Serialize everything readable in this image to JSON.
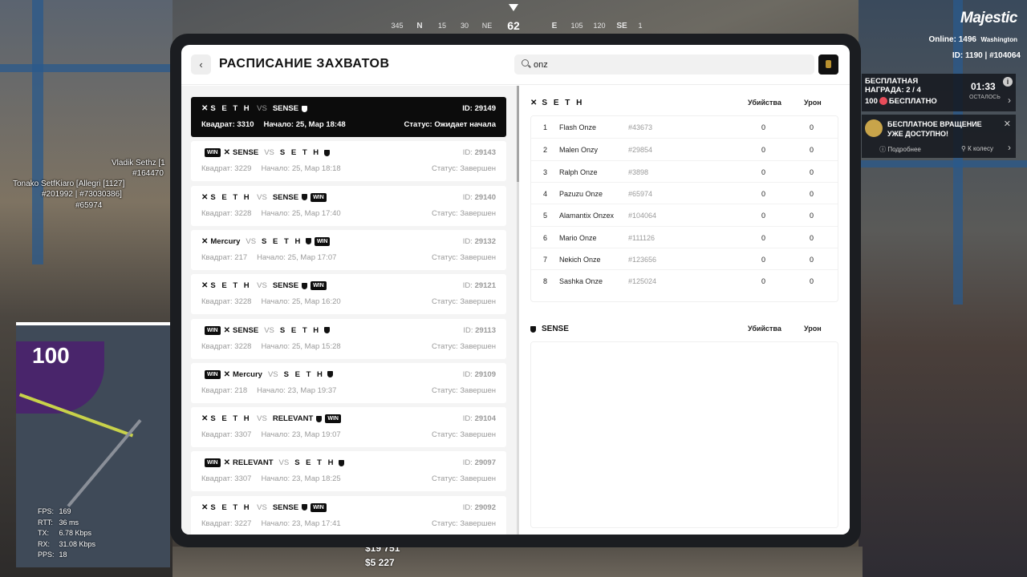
{
  "compass": {
    "heading": "62",
    "marks": [
      "345",
      "N",
      "15",
      "30",
      "NE",
      "E",
      "105",
      "120",
      "SE",
      "1"
    ]
  },
  "players": [
    "Vladik Sethz [1",
    "#164470",
    "Tonako SetfKiaro [Allegri [1127]",
    "#201992 | #73030386]",
    "#65974"
  ],
  "minimap": {
    "level": "100"
  },
  "stats": [
    {
      "k": "FPS:",
      "v": "169"
    },
    {
      "k": "RTT:",
      "v": "36 ms"
    },
    {
      "k": "TX:",
      "v": "6.78 Kbps"
    },
    {
      "k": "RX:",
      "v": "31.08 Kbps"
    },
    {
      "k": "PPS:",
      "v": "18"
    }
  ],
  "money": {
    "cash": "$19 751",
    "bank": "$5 227"
  },
  "hud": {
    "logo": "Majestic",
    "online": "Online: 1496",
    "server": "Washington",
    "ids": "ID: 1190 | #104064",
    "reward_title": "БЕСПЛАТНАЯ НАГРАДА: 2 / 4",
    "reward_sub_num": "100",
    "reward_sub": "БЕСПЛАТНО",
    "reward_time": "01:33",
    "reward_time_label": "ОСТАЛОСЬ",
    "spin_title": "БЕСПЛАТНОЕ ВРАЩЕНИЕ УЖЕ ДОСТУПНО!",
    "spin_more": "Подробнее",
    "spin_wheel": "К колесу"
  },
  "header": {
    "title": "РАСПИСАНИЕ ЗАХВАТОВ",
    "search_value": "onz"
  },
  "labels": {
    "vs": "VS",
    "win": "WIN",
    "square": "Квадрат:",
    "start": "Начало:",
    "status": "Статус:",
    "id": "ID:"
  },
  "captures": [
    {
      "a": "S E T H",
      "b": "SENSE",
      "win": "",
      "id": "29149",
      "square": "3310",
      "start": "25, Мар 18:48",
      "status": "Ожидает начала"
    },
    {
      "a": "SENSE",
      "b": "S E T H",
      "win": "a",
      "id": "29143",
      "square": "3229",
      "start": "25, Мар 18:18",
      "status": "Завершен"
    },
    {
      "a": "S E T H",
      "b": "SENSE",
      "win": "b",
      "id": "29140",
      "square": "3228",
      "start": "25, Мар 17:40",
      "status": "Завершен"
    },
    {
      "a": "Mercury",
      "b": "S E T H",
      "win": "b",
      "id": "29132",
      "square": "217",
      "start": "25, Мар 17:07",
      "status": "Завершен"
    },
    {
      "a": "S E T H",
      "b": "SENSE",
      "win": "b",
      "id": "29121",
      "square": "3228",
      "start": "25, Мар 16:20",
      "status": "Завершен"
    },
    {
      "a": "SENSE",
      "b": "S E T H",
      "win": "a",
      "id": "29113",
      "square": "3228",
      "start": "25, Мар 15:28",
      "status": "Завершен"
    },
    {
      "a": "Mercury",
      "b": "S E T H",
      "win": "a",
      "id": "29109",
      "square": "218",
      "start": "23, Мар 19:37",
      "status": "Завершен"
    },
    {
      "a": "S E T H",
      "b": "RELEVANT",
      "win": "b",
      "id": "29104",
      "square": "3307",
      "start": "23, Мар 19:07",
      "status": "Завершен"
    },
    {
      "a": "RELEVANT",
      "b": "S E T H",
      "win": "a",
      "id": "29097",
      "square": "3307",
      "start": "23, Мар 18:25",
      "status": "Завершен"
    },
    {
      "a": "S E T H",
      "b": "SENSE",
      "win": "b",
      "id": "29092",
      "square": "3227",
      "start": "23, Мар 17:41",
      "status": "Завершен"
    }
  ],
  "detail": {
    "team1": "S E T H",
    "team2": "SENSE",
    "kills_label": "Убийства",
    "damage_label": "Урон",
    "players": [
      {
        "n": "1",
        "name": "Flash Onze",
        "id": "#43673",
        "kills": "0",
        "damage": "0"
      },
      {
        "n": "2",
        "name": "Malen Onzy",
        "id": "#29854",
        "kills": "0",
        "damage": "0"
      },
      {
        "n": "3",
        "name": "Ralph Onze",
        "id": "#3898",
        "kills": "0",
        "damage": "0"
      },
      {
        "n": "4",
        "name": "Pazuzu Onze",
        "id": "#65974",
        "kills": "0",
        "damage": "0"
      },
      {
        "n": "5",
        "name": "Alamantix Onzex",
        "id": "#104064",
        "kills": "0",
        "damage": "0"
      },
      {
        "n": "6",
        "name": "Mario Onze",
        "id": "#111126",
        "kills": "0",
        "damage": "0"
      },
      {
        "n": "7",
        "name": "Nekich Onze",
        "id": "#123656",
        "kills": "0",
        "damage": "0"
      },
      {
        "n": "8",
        "name": "Sashka Onze",
        "id": "#125024",
        "kills": "0",
        "damage": "0"
      }
    ]
  }
}
